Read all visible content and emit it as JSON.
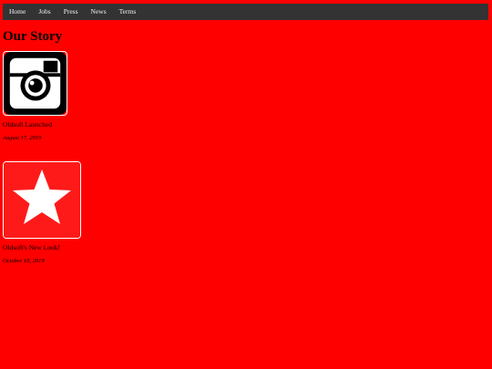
{
  "nav": {
    "items": [
      {
        "label": "Home"
      },
      {
        "label": "Jobs"
      },
      {
        "label": "Press"
      },
      {
        "label": "News"
      },
      {
        "label": "Terms"
      }
    ]
  },
  "page": {
    "title": "Our Story"
  },
  "stories": [
    {
      "icon": "camera-icon",
      "title": "Oldsoft Launched",
      "date": "August 17, 2019"
    },
    {
      "icon": "star-icon",
      "title": "Oldsoft's New Look!",
      "date": "October 18, 2019"
    }
  ],
  "colors": {
    "page_background": "#ff0000",
    "navbar_background": "#333333",
    "nav_text": "#f2f2f2"
  }
}
